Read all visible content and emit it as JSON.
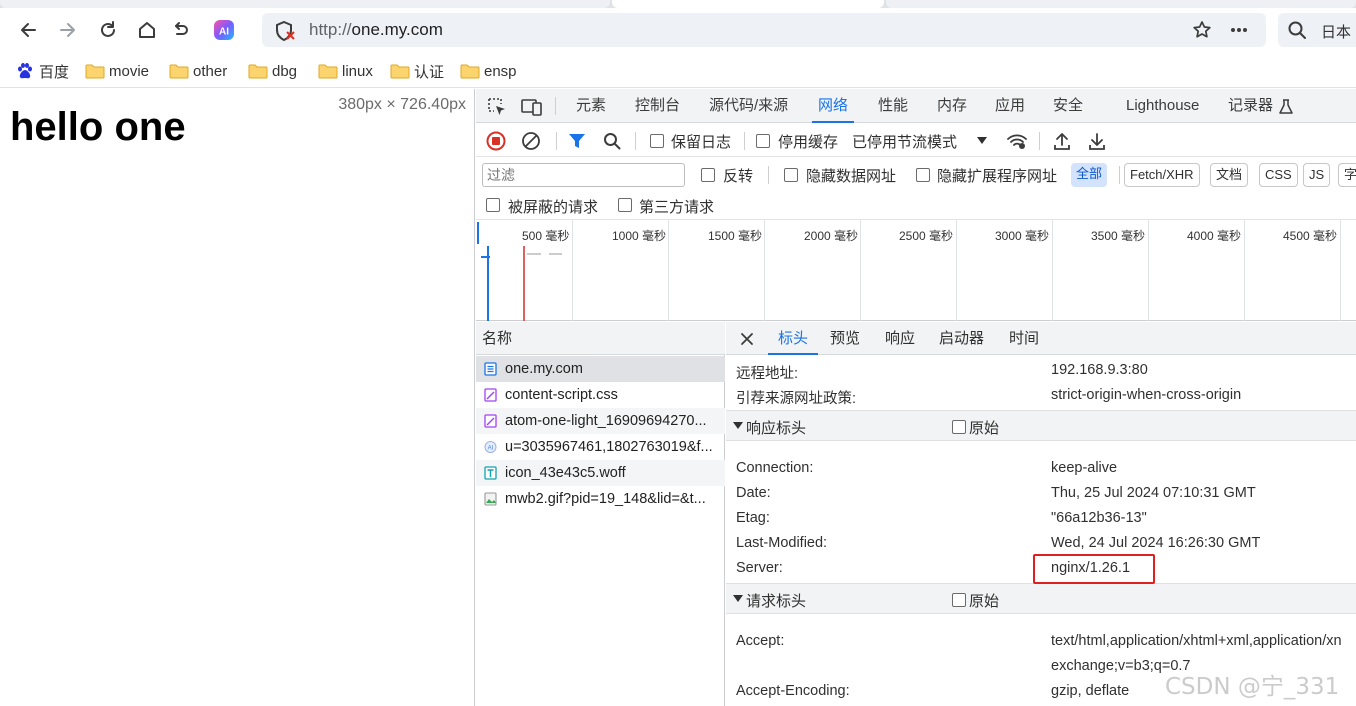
{
  "toolbar": {
    "url_scheme": "http://",
    "url_host": "one.my.com",
    "search_text": "日本"
  },
  "bookmarks": [
    {
      "label": "百度",
      "icon": "baidu-paw-icon"
    },
    {
      "label": "movie",
      "icon": "folder-icon"
    },
    {
      "label": "other",
      "icon": "folder-icon"
    },
    {
      "label": "dbg",
      "icon": "folder-icon"
    },
    {
      "label": "linux",
      "icon": "folder-icon"
    },
    {
      "label": "认证",
      "icon": "folder-icon"
    },
    {
      "label": "ensp",
      "icon": "folder-icon"
    }
  ],
  "page": {
    "heading": "hello one",
    "viewport_size": "380px × 726.40px"
  },
  "devtools": {
    "tabs": [
      "元素",
      "控制台",
      "源代码/来源",
      "网络",
      "性能",
      "内存",
      "应用",
      "安全",
      "Lighthouse",
      "记录器"
    ],
    "active_tab": "网络",
    "network_toolbar": {
      "preserve_log": "保留日志",
      "disable_cache": "停用缓存",
      "throttle": "已停用节流模式"
    },
    "filter": {
      "placeholder": "过滤",
      "invert": "反转",
      "hide_data_urls": "隐藏数据网址",
      "hide_ext_urls": "隐藏扩展程序网址",
      "chips": [
        "全部",
        "Fetch/XHR",
        "文档",
        "CSS",
        "JS",
        "字"
      ],
      "active_chip": "全部",
      "blocked_requests": "被屏蔽的请求",
      "third_party": "第三方请求"
    },
    "timeline_ticks": [
      "500 毫秒",
      "1000 毫秒",
      "1500 毫秒",
      "2000 毫秒",
      "2500 毫秒",
      "3000 毫秒",
      "3500 毫秒",
      "4000 毫秒",
      "4500 毫秒"
    ],
    "requests": {
      "header": "名称",
      "items": [
        {
          "name": "one.my.com",
          "icon": "document-icon",
          "color": "#1a73e8"
        },
        {
          "name": "content-script.css",
          "icon": "stylesheet-icon",
          "color": "#a142f4"
        },
        {
          "name": "atom-one-light_16909694270...",
          "icon": "stylesheet-icon",
          "color": "#a142f4"
        },
        {
          "name": "u=3035967461,1802763019&f...",
          "icon": "image-thumbnail-icon",
          "color": "#4285f4"
        },
        {
          "name": "icon_43e43c5.woff",
          "icon": "font-icon",
          "color": "#12a4af"
        },
        {
          "name": "mwb2.gif?pid=19_148&lid=&t...",
          "icon": "image-icon",
          "color": "#34a853"
        }
      ]
    },
    "details": {
      "tabs": [
        "标头",
        "预览",
        "响应",
        "启动器",
        "时间"
      ],
      "active_tab": "标头",
      "general": [
        {
          "key": "远程地址:",
          "value": "192.168.9.3:80"
        },
        {
          "key": "引荐来源网址政策:",
          "value": "strict-origin-when-cross-origin"
        }
      ],
      "response_headers_title": "响应标头",
      "raw_label": "原始",
      "response_headers": [
        {
          "key": "Connection:",
          "value": "keep-alive"
        },
        {
          "key": "Date:",
          "value": "Thu, 25 Jul 2024 07:10:31 GMT"
        },
        {
          "key": "Etag:",
          "value": "\"66a12b36-13\""
        },
        {
          "key": "Last-Modified:",
          "value": "Wed, 24 Jul 2024 16:26:30 GMT"
        },
        {
          "key": "Server:",
          "value": "nginx/1.26.1"
        }
      ],
      "request_headers_title": "请求标头",
      "request_headers": [
        {
          "key": "Accept:",
          "value": "text/html,application/xhtml+xml,application/xn"
        },
        {
          "key": "",
          "value": "exchange;v=b3;q=0.7"
        },
        {
          "key": "Accept-Encoding:",
          "value": "gzip, deflate"
        }
      ]
    }
  },
  "watermark": "CSDN @宁_331",
  "colors": {
    "accent": "#1a73e8",
    "highlight": "#e02020",
    "record_stop": "#d93025"
  }
}
